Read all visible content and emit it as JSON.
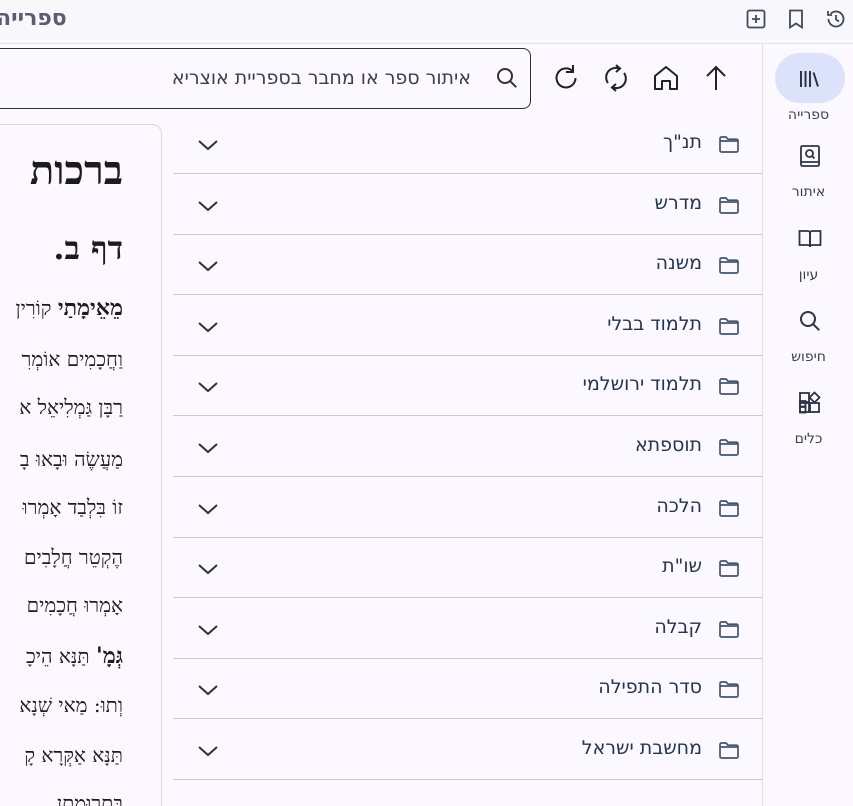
{
  "app": {
    "title": "ספרייה"
  },
  "rail": {
    "items": [
      {
        "label": "ספרייה",
        "icon": "library-icon",
        "active": true
      },
      {
        "label": "איתור",
        "icon": "book-search-icon",
        "active": false
      },
      {
        "label": "עיון",
        "icon": "open-book-icon",
        "active": false
      },
      {
        "label": "חיפוש",
        "icon": "search-icon",
        "active": false
      },
      {
        "label": "כלים",
        "icon": "widgets-icon",
        "active": false
      }
    ]
  },
  "search": {
    "placeholder": "איתור ספר או מחבר בספריית אוצריא"
  },
  "categories": [
    {
      "label": "תנ\"ך"
    },
    {
      "label": "מדרש"
    },
    {
      "label": "משנה"
    },
    {
      "label": "תלמוד בבלי"
    },
    {
      "label": "תלמוד ירושלמי"
    },
    {
      "label": "תוספתא"
    },
    {
      "label": "הלכה"
    },
    {
      "label": "שו\"ת"
    },
    {
      "label": "קבלה"
    },
    {
      "label": "סדר התפילה"
    },
    {
      "label": "מחשבת ישראל"
    }
  ],
  "reader": {
    "book_title": "ברכות",
    "daf_title": "דף ב.",
    "lines": [
      {
        "bold": "מֵאֵימָתַי",
        "text": " קוֹרִין"
      },
      {
        "bold": "",
        "text": "וַחֲכָמִים אוֹמְרִ"
      },
      {
        "bold": "",
        "text": "רַבָּן גַּמְלִיאֵל א"
      },
      {
        "bold": "",
        "text": "מַעֲשֶׂה וּבָאוּ בָ"
      },
      {
        "bold": "",
        "text": "זוֹ בִּלְבַד אָמְרוּ"
      },
      {
        "bold": "",
        "text": "הֶקְטֵר חֲלָבִים"
      },
      {
        "bold": "",
        "text": "אָמְרוּ חֲכָמִים"
      },
      {
        "bold": "גְּמָ'",
        "text": " תַּנָּא הֵיכָ"
      },
      {
        "bold": "",
        "text": "וְתוּ: מַאי שְׁנָא"
      },
      {
        "bold": "",
        "text": "תַּנָּא אַקְּרָא קָ"
      },
      {
        "bold": "",
        "text": "בִּתְרוּמָתָן."
      }
    ]
  }
}
